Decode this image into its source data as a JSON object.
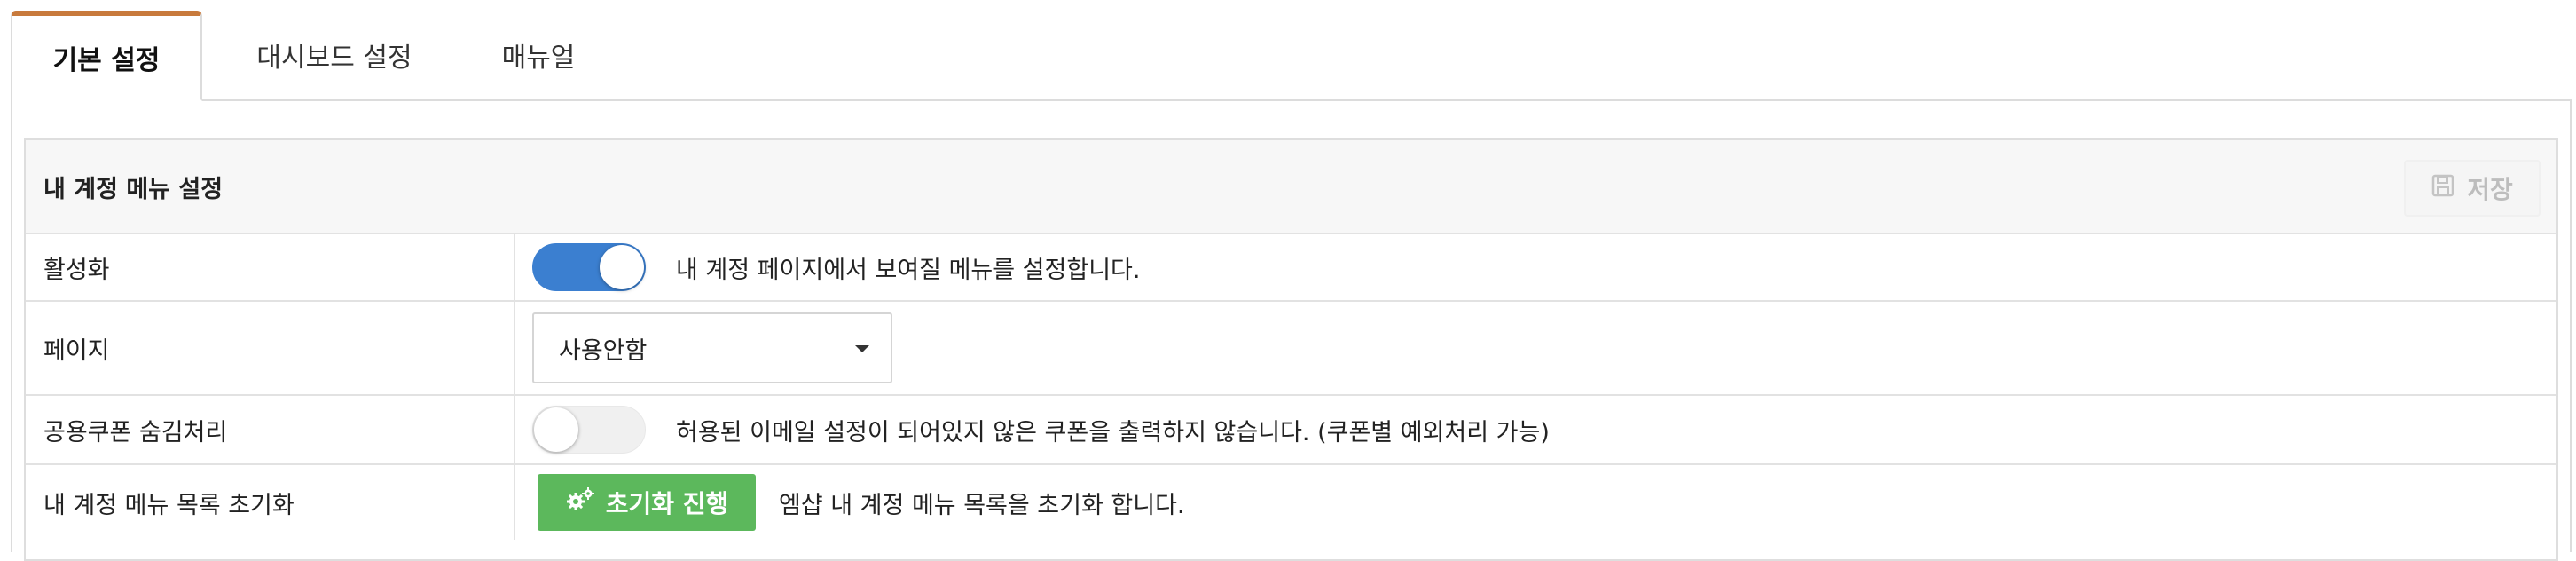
{
  "tabs": [
    {
      "label": "기본 설정",
      "active": true
    },
    {
      "label": "대시보드 설정",
      "active": false
    },
    {
      "label": "매뉴얼",
      "active": false
    }
  ],
  "section": {
    "title": "내 계정 메뉴 설정",
    "save_label": "저장",
    "save_icon": "floppy-disk-icon"
  },
  "rows": {
    "activation": {
      "label": "활성화",
      "toggle_on": true,
      "description": "내 계정 페이지에서 보여질 메뉴를 설정합니다."
    },
    "page": {
      "label": "페이지",
      "selected": "사용안함"
    },
    "coupon": {
      "label": "공용쿠폰 숨김처리",
      "toggle_on": false,
      "description": "허용된 이메일 설정이 되어있지 않은 쿠폰을 출력하지 않습니다. (쿠폰별 예외처리 가능)"
    },
    "reset": {
      "label": "내 계정 메뉴 목록 초기화",
      "button_label": "초기화 진행",
      "button_icon": "gears-icon",
      "description": "엠샵 내 계정 메뉴 목록을 초기화 합니다."
    }
  },
  "colors": {
    "tab_accent": "#c87a3c",
    "toggle_on": "#3b7fd0",
    "button_green": "#5cb85c"
  }
}
